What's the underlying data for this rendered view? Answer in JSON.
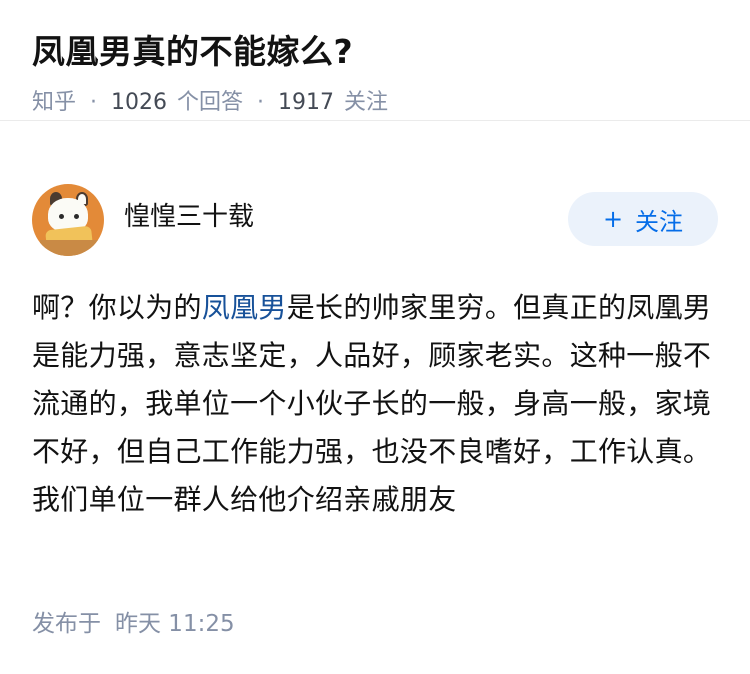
{
  "question": {
    "title": "凤凰男真的不能嫁么?",
    "source": "知乎",
    "answer_count": "1026",
    "answer_unit": "个回答",
    "follower_count": "1917",
    "follower_unit": "关注",
    "separator": "·"
  },
  "author": {
    "name": "惶惶三十载",
    "follow_label": "关注",
    "follow_icon": "+"
  },
  "answer": {
    "text_before": "啊？你以为的",
    "keyword": "凤凰男",
    "text_after": "是长的帅家里穷。但真正的凤凰男是能力强，意志坚定，人品好，顾家老实。这种一般不流通的，我单位一个小伙子长的一般，身高一般，家境不好，但自己工作能力强，也没不良嗜好，工作认真。我们单位一群人给他介绍亲戚朋友"
  },
  "footer": {
    "published_label": "发布于",
    "published_time": "昨天 11:25"
  },
  "colors": {
    "link": "#175199",
    "accent": "#056de8",
    "button_bg": "#ebf2fb",
    "meta": "#8590a6"
  }
}
